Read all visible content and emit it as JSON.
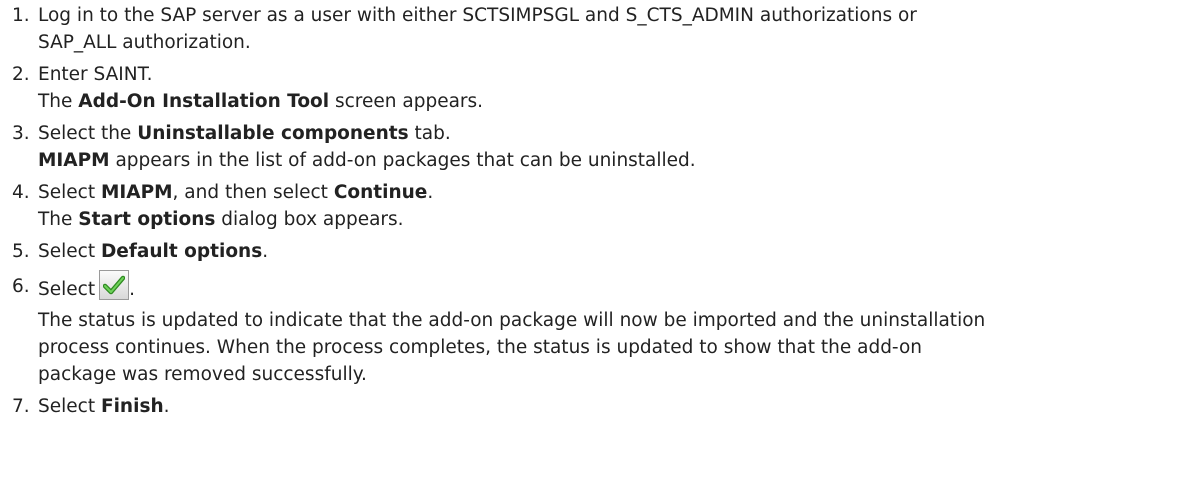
{
  "steps": [
    {
      "num": "1.",
      "line1": "Log in to the SAP server as a user with either SCTSIMPSGL and S_CTS_ADMIN authorizations or",
      "line2": "SAP_ALL authorization."
    },
    {
      "num": "2.",
      "line1": "Enter SAINT.",
      "result_pre": "The ",
      "result_bold": "Add-On Installation Tool",
      "result_post": " screen appears."
    },
    {
      "num": "3.",
      "pre": "Select the ",
      "bold": "Uninstallable components",
      "post": " tab.",
      "result_bold": "MIAPM",
      "result_post": " appears in the list of add-on packages that can be uninstalled."
    },
    {
      "num": "4.",
      "pre": "Select ",
      "bold1": "MIAPM",
      "mid": ", and then select ",
      "bold2": "Continue",
      "post": ".",
      "result_pre": "The ",
      "result_bold": "Start options",
      "result_post": " dialog box appears."
    },
    {
      "num": "5.",
      "pre": "Select ",
      "bold": "Default options",
      "post": "."
    },
    {
      "num": "6.",
      "pre": "Select",
      "post": ".",
      "icon": "green-checkmark-icon",
      "icon_color": "#3a9a2a",
      "result_line1": "The status is updated to indicate that the add-on package will now be imported and the uninstallation",
      "result_line2": "process continues. When the process completes, the status is updated to show that the add-on",
      "result_line3": "package was removed successfully."
    },
    {
      "num": "7.",
      "pre": "Select ",
      "bold": "Finish",
      "post": "."
    }
  ]
}
